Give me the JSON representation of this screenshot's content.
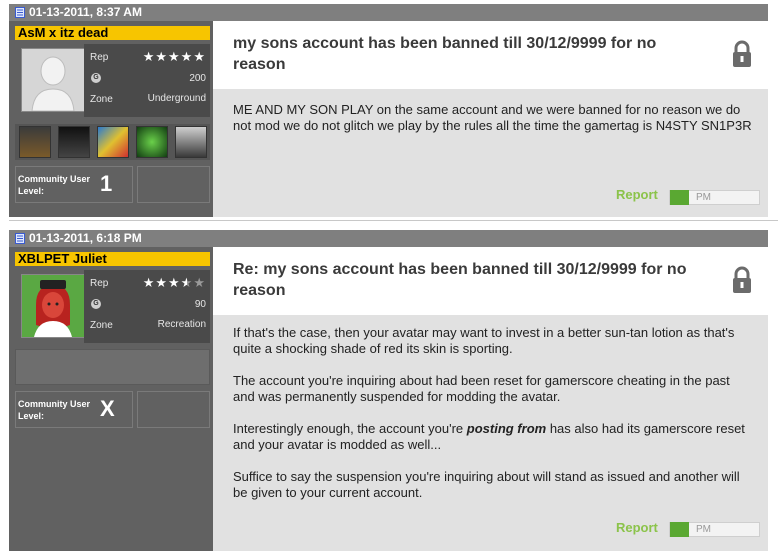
{
  "posts": [
    {
      "timestamp": "01-13-2011, 8:37 AM",
      "gamertag": "AsM x itz dead",
      "rep_label": "Rep",
      "rep_stars": "★★★★★",
      "gamerscore_badge": "G",
      "gamerscore": "200",
      "zone_label": "Zone",
      "zone": "Underground",
      "community_label": "Community User Level:",
      "community_level": "1",
      "title": "my sons account has been banned till 30/12/9999 for no reason",
      "body": [
        "ME AND MY SON PLAY on the same account and we were banned for no reason we do not mod we do not glitch we play by the rules all the time the gamertag is N4STY SN1P3R"
      ],
      "report_label": "Report",
      "pm_label": "PM"
    },
    {
      "timestamp": "01-13-2011, 6:18 PM",
      "gamertag": "XBLPET Juliet",
      "rep_label": "Rep",
      "rep_stars": "★★★★★",
      "gamerscore_badge": "G",
      "gamerscore": "90",
      "zone_label": "Zone",
      "zone": "Recreation",
      "community_label": "Community User Level:",
      "community_level": "X",
      "title": "Re: my sons account has been banned till 30/12/9999 for no reason",
      "body": [
        "If that's the case, then your avatar may want to invest in a better sun-tan lotion as that's quite a shocking shade of red its skin is sporting.",
        "The account you're inquiring about had been reset for gamerscore cheating in the past and was permanently suspended for modding the avatar.",
        "Interestingly enough, the account you're",
        "posting from",
        "has also had its gamerscore reset and your avatar is modded as well...",
        "Suffice to say the suspension you're inquiring about will stand as issued and another will be given to your current account."
      ],
      "report_label": "Report",
      "pm_label": "PM"
    }
  ],
  "colors": {
    "header_bg": "#7f7f7f",
    "gamertag_bg": "#f7c500",
    "report_green": "#8bc34a",
    "pm_icon_green": "#5aa832"
  },
  "icons": [
    "document-icon",
    "lock-icon",
    "pm-icon"
  ]
}
